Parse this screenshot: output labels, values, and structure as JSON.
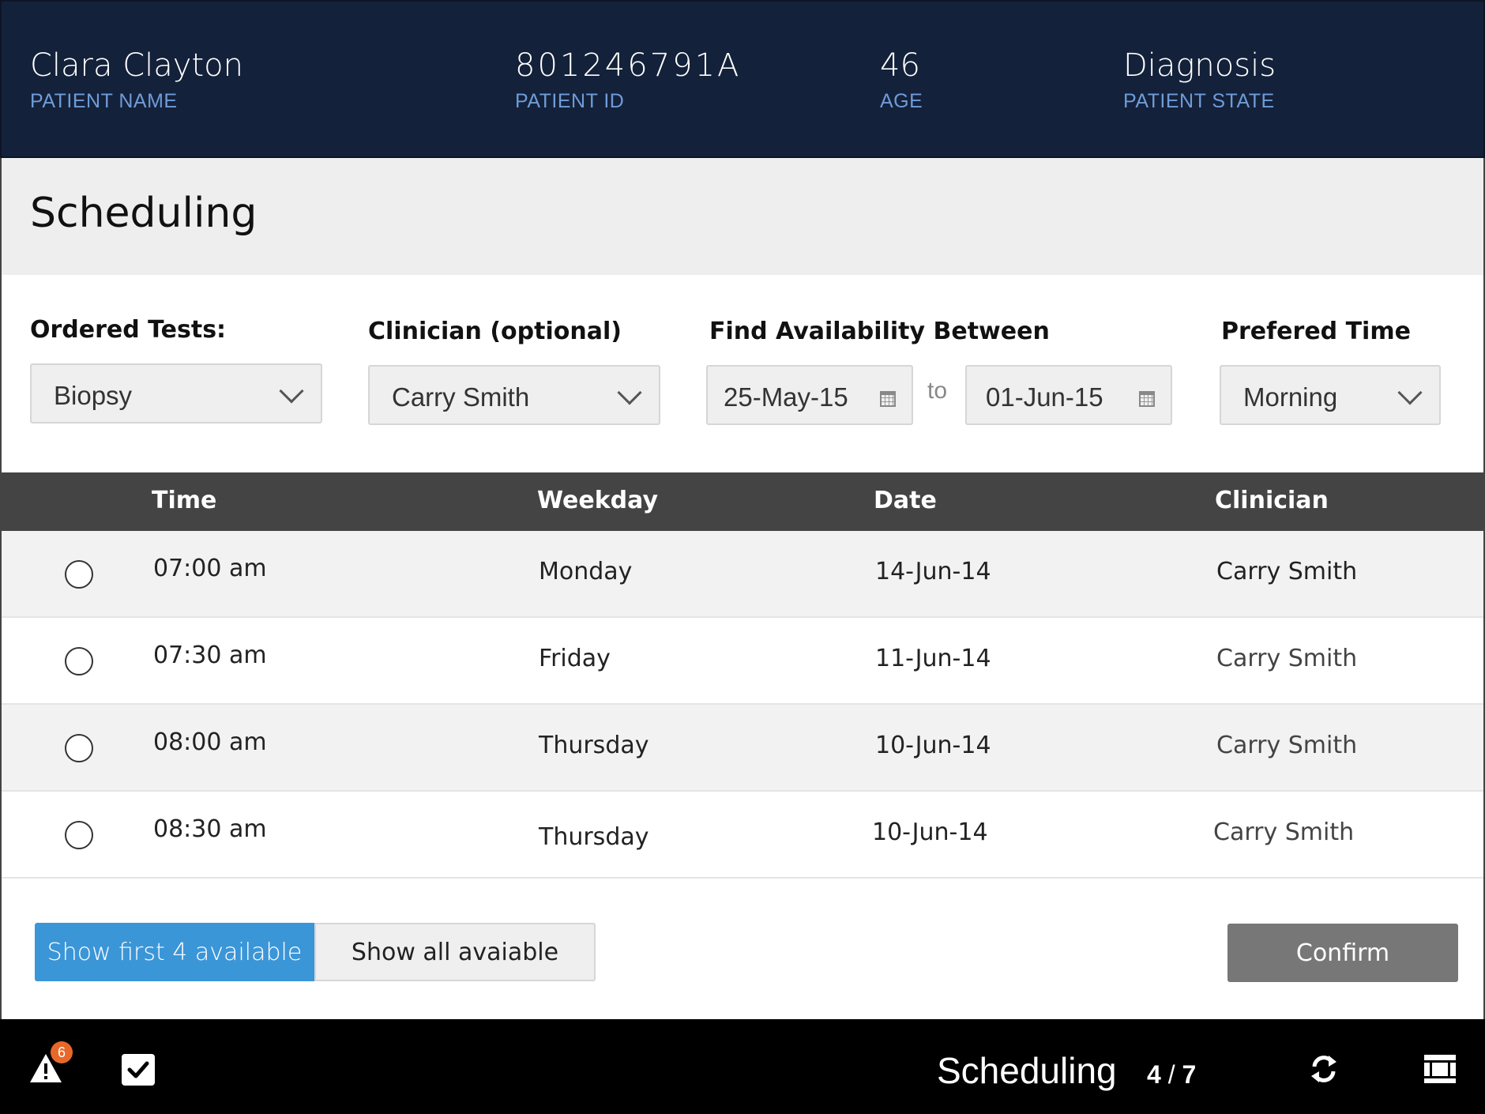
{
  "patient": {
    "name": "Clara Clayton",
    "name_label": "PATIENT NAME",
    "id": "801246791A",
    "id_label": "PATIENT ID",
    "age": "46",
    "age_label": "AGE",
    "state": "Diagnosis",
    "state_label": "PATIENT STATE"
  },
  "page": {
    "title": "Scheduling"
  },
  "filters": {
    "ordered_tests": {
      "label": "Ordered Tests:",
      "value": "Biopsy"
    },
    "clinician": {
      "label": "Clinician (optional)",
      "value": "Carry Smith"
    },
    "availability": {
      "label": "Find Availability Between",
      "from": "25-May-15",
      "to_text": "to",
      "to": "01-Jun-15"
    },
    "preferred_time": {
      "label": "Prefered Time",
      "value": "Morning"
    }
  },
  "table": {
    "headers": {
      "time": "Time",
      "weekday": "Weekday",
      "date": "Date",
      "clinician": "Clinician"
    },
    "rows": [
      {
        "time": "07:00 am",
        "weekday": "Monday",
        "date": "14-Jun-14",
        "clinician": "Carry Smith"
      },
      {
        "time": "07:30 am",
        "weekday": "Friday",
        "date": "11-Jun-14",
        "clinician": "Carry Smith"
      },
      {
        "time": "08:00 am",
        "weekday": "Thursday",
        "date": "10-Jun-14",
        "clinician": "Carry Smith"
      },
      {
        "time": "08:30 am",
        "weekday": "Thursday",
        "date": "10-Jun-14",
        "clinician": "Carry Smith"
      }
    ]
  },
  "actions": {
    "show_first": "Show first 4 available",
    "show_all": "Show all avaiable",
    "confirm": "Confirm"
  },
  "footer": {
    "alert_count": "6",
    "title": "Scheduling",
    "page_current": "4",
    "page_sep": "/",
    "page_total": "7"
  },
  "colors": {
    "header_bg": "#14213a",
    "label_blue": "#6f9cd8",
    "accent_blue": "#3b96d8",
    "table_head": "#444444",
    "badge_orange": "#e8682a",
    "confirm_gray": "#777777"
  },
  "icons": [
    "warning-icon",
    "checkbox-icon",
    "refresh-icon",
    "layout-icon",
    "calendar-icon",
    "chevron-down-icon"
  ]
}
